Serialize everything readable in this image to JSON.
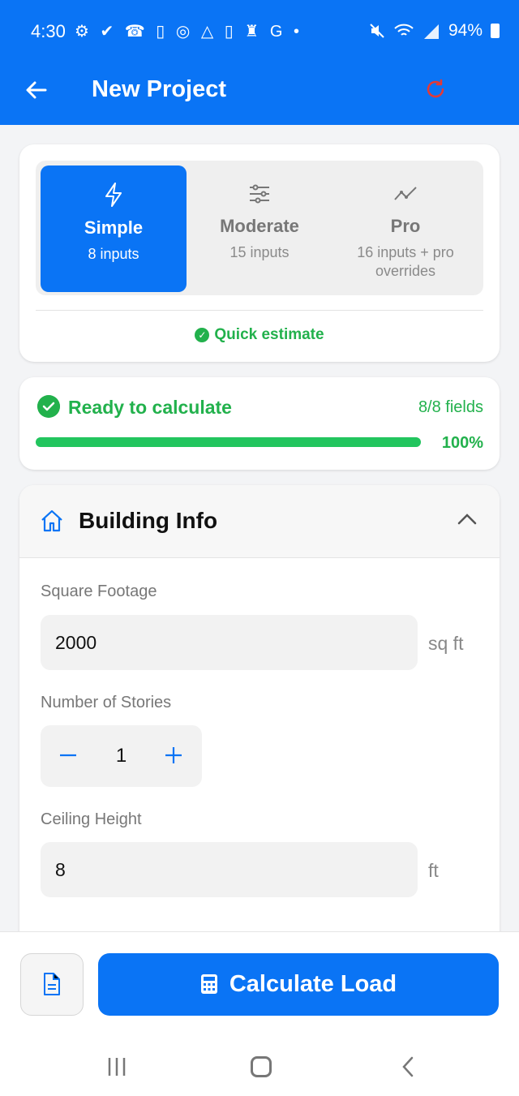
{
  "status": {
    "time": "4:30",
    "icons": "⚙ ✔ ☎ ▯ ◎ △ ▯ ♜ G •",
    "battery": "94%"
  },
  "appbar": {
    "title": "New Project",
    "back_icon": "arrow-left-icon",
    "reset_icon": "refresh-icon"
  },
  "modes": [
    {
      "label": "Simple",
      "sub": "8 inputs",
      "icon": "lightning-icon",
      "active": true
    },
    {
      "label": "Moderate",
      "sub": "15 inputs",
      "icon": "sliders-icon",
      "active": false
    },
    {
      "label": "Pro",
      "sub": "16 inputs + pro overrides",
      "icon": "trend-line-icon",
      "active": false
    }
  ],
  "mode_note": "Quick estimate",
  "progress": {
    "label": "Ready to calculate",
    "fields": "8/8 fields",
    "percent_text": "100%",
    "fraction": 1.0
  },
  "building_info": {
    "title": "Building Info",
    "square_footage": {
      "label": "Square Footage",
      "value": "2000",
      "unit": "sq ft"
    },
    "stories": {
      "label": "Number of Stories",
      "value": "1"
    },
    "ceiling": {
      "label": "Ceiling Height",
      "value": "8",
      "unit": "ft"
    }
  },
  "actions": {
    "calculate_label": "Calculate Load",
    "doc_icon": "document-icon",
    "calc_icon": "calculator-icon"
  },
  "colors": {
    "primary": "#0a74f5",
    "success": "#22b14c",
    "reset": "#e53935"
  }
}
